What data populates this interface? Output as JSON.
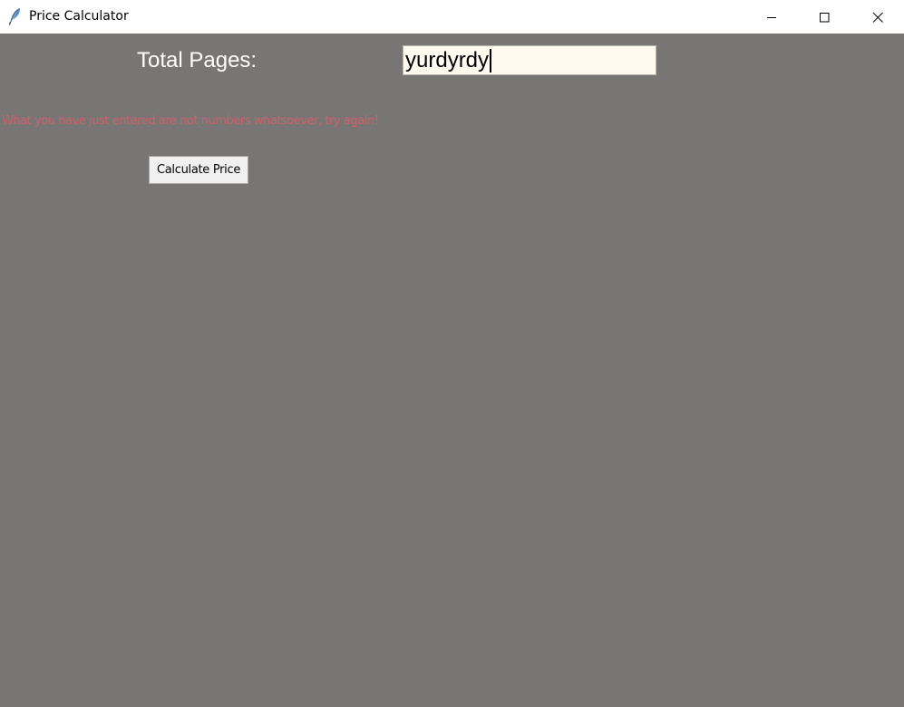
{
  "window": {
    "title": "Price Calculator",
    "background": "#787674",
    "icon": "feather-icon",
    "controls": {
      "minimize_icon": "minimize-icon",
      "maximize_icon": "maximize-icon",
      "close_icon": "close-icon"
    }
  },
  "form": {
    "total_pages_label": "Total Pages:",
    "total_pages_value": "yurdyrdy",
    "error_message": "What you have just entered are not numbers whatsoever, try again!",
    "error_color": "#cf5f6a",
    "calculate_button_label": "Calculate Price"
  }
}
